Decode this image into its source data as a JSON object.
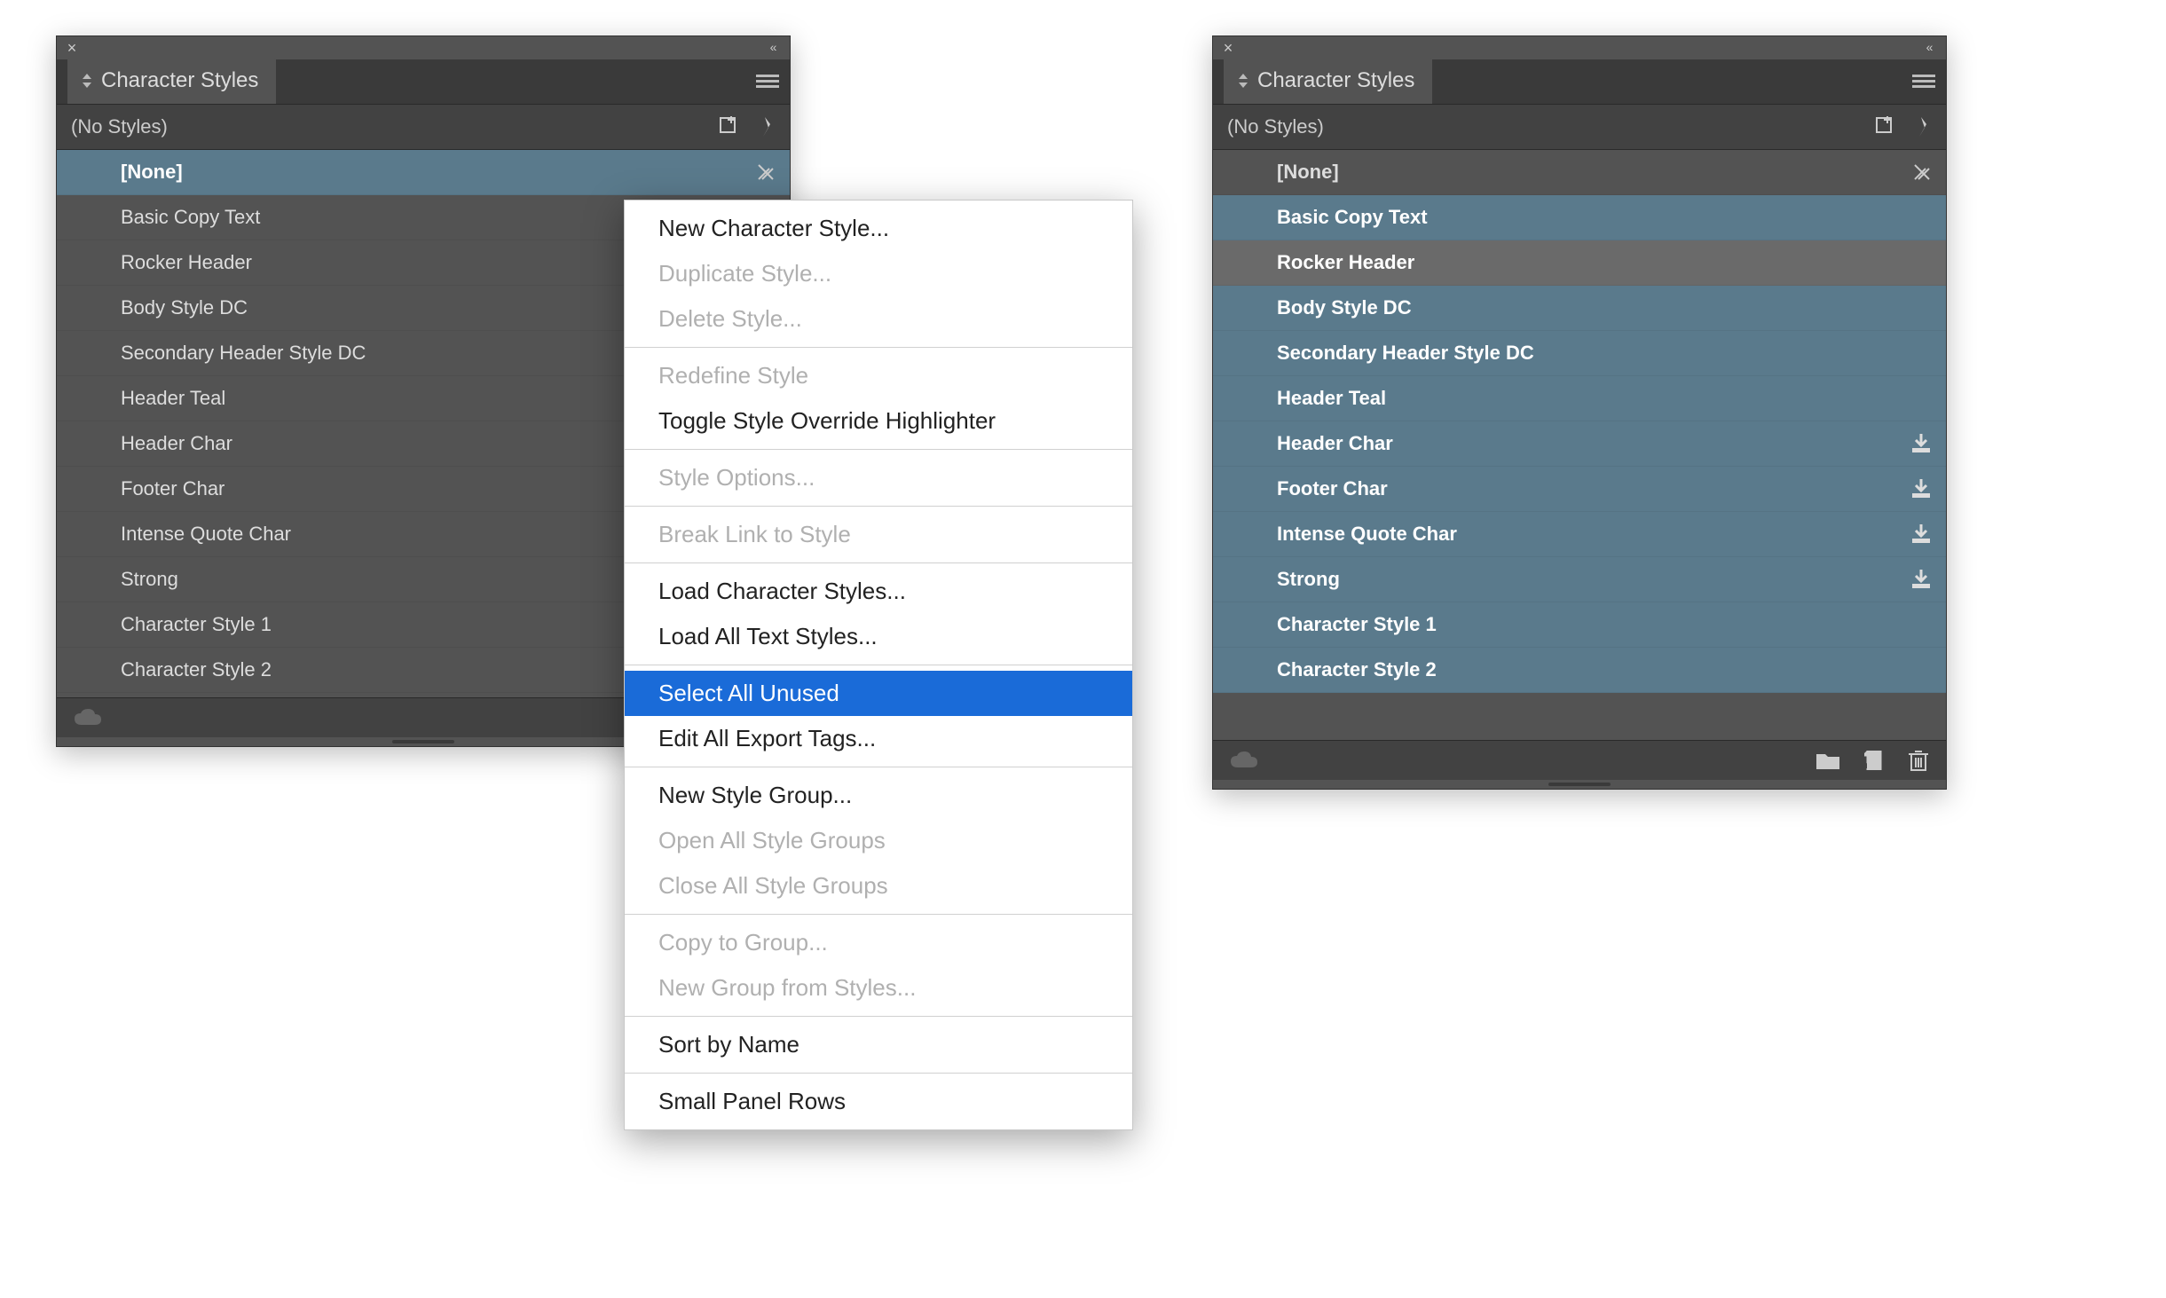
{
  "panel_left": {
    "tab_title": "Character Styles",
    "subheader": "(No Styles)",
    "styles": [
      {
        "label": "[None]",
        "selected": "blue",
        "bold": true,
        "edit_icon": true
      },
      {
        "label": "Basic Copy Text"
      },
      {
        "label": "Rocker Header"
      },
      {
        "label": "Body Style DC"
      },
      {
        "label": "Secondary Header Style DC"
      },
      {
        "label": "Header Teal"
      },
      {
        "label": "Header Char"
      },
      {
        "label": "Footer Char"
      },
      {
        "label": "Intense Quote Char"
      },
      {
        "label": "Strong"
      },
      {
        "label": "Character Style 1"
      },
      {
        "label": "Character Style 2"
      }
    ]
  },
  "panel_right": {
    "tab_title": "Character Styles",
    "subheader": "(No Styles)",
    "styles": [
      {
        "label": "[None]",
        "bold": true,
        "edit_icon": true
      },
      {
        "label": "Basic Copy Text",
        "selected": "blue",
        "bold": true
      },
      {
        "label": "Rocker Header",
        "selected": "gray",
        "bold": true
      },
      {
        "label": "Body Style DC",
        "selected": "blue",
        "bold": true
      },
      {
        "label": "Secondary Header Style DC",
        "selected": "blue",
        "bold": true
      },
      {
        "label": "Header Teal",
        "selected": "blue",
        "bold": true
      },
      {
        "label": "Header Char",
        "selected": "blue",
        "bold": true,
        "import_icon": true
      },
      {
        "label": "Footer Char",
        "selected": "blue",
        "bold": true,
        "import_icon": true
      },
      {
        "label": "Intense Quote Char",
        "selected": "blue",
        "bold": true,
        "import_icon": true
      },
      {
        "label": "Strong",
        "selected": "blue",
        "bold": true,
        "import_icon": true
      },
      {
        "label": "Character Style 1",
        "selected": "blue",
        "bold": true
      },
      {
        "label": "Character Style 2",
        "selected": "blue",
        "bold": true
      }
    ]
  },
  "context_menu": {
    "groups": [
      [
        {
          "label": "New Character Style...",
          "enabled": true
        },
        {
          "label": "Duplicate Style...",
          "enabled": false
        },
        {
          "label": "Delete Style...",
          "enabled": false
        }
      ],
      [
        {
          "label": "Redefine Style",
          "enabled": false
        },
        {
          "label": "Toggle Style Override Highlighter",
          "enabled": true
        }
      ],
      [
        {
          "label": "Style Options...",
          "enabled": false
        }
      ],
      [
        {
          "label": "Break Link to Style",
          "enabled": false
        }
      ],
      [
        {
          "label": "Load Character Styles...",
          "enabled": true
        },
        {
          "label": "Load All Text Styles...",
          "enabled": true
        }
      ],
      [
        {
          "label": "Select All Unused",
          "enabled": true,
          "highlight": true
        },
        {
          "label": "Edit All Export Tags...",
          "enabled": true
        }
      ],
      [
        {
          "label": "New Style Group...",
          "enabled": true
        },
        {
          "label": "Open All Style Groups",
          "enabled": false
        },
        {
          "label": "Close All Style Groups",
          "enabled": false
        }
      ],
      [
        {
          "label": "Copy to Group...",
          "enabled": false
        },
        {
          "label": "New Group from Styles...",
          "enabled": false
        }
      ],
      [
        {
          "label": "Sort by Name",
          "enabled": true
        }
      ],
      [
        {
          "label": "Small Panel Rows",
          "enabled": true
        }
      ]
    ]
  }
}
